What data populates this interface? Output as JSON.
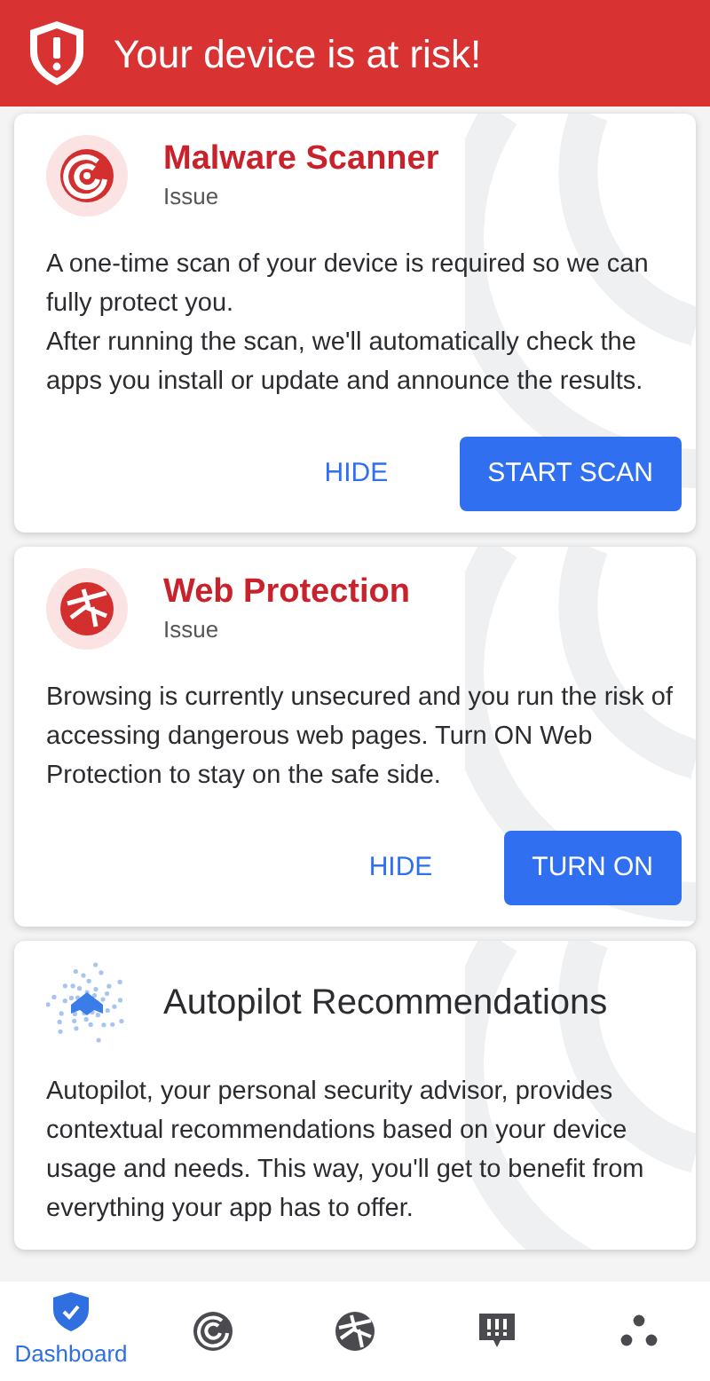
{
  "header": {
    "title": "Your device is at risk!"
  },
  "cards": [
    {
      "kind": "scanner",
      "title": "Malware Scanner",
      "status": "Issue",
      "alert": true,
      "paragraphs": [
        "A one-time scan of your device is required so we can fully protect you.",
        "After running the scan, we'll automatically check the apps you install or update and announce the results."
      ],
      "buttons": [
        {
          "kind": "text",
          "label": "HIDE"
        },
        {
          "kind": "primary",
          "label": "START SCAN"
        }
      ]
    },
    {
      "kind": "web",
      "title": "Web Protection",
      "status": "Issue",
      "alert": true,
      "paragraphs": [
        "Browsing is currently unsecured and you run the risk of accessing dangerous web pages. Turn ON Web Protection to stay on the safe side."
      ],
      "buttons": [
        {
          "kind": "text",
          "label": "HIDE"
        },
        {
          "kind": "primary",
          "label": "TURN ON"
        }
      ]
    },
    {
      "kind": "autopilot",
      "title": "Autopilot Recommendations",
      "alert": false,
      "paragraphs": [
        "Autopilot, your personal security advisor, provides contextual recommendations based on your device usage and needs. This way, you'll get to benefit from everything your app has to offer."
      ]
    }
  ],
  "nav": [
    {
      "kind": "dashboard",
      "label": "Dashboard",
      "selected": true
    },
    {
      "kind": "scanner",
      "selected": false
    },
    {
      "kind": "web",
      "selected": false
    },
    {
      "kind": "messages",
      "selected": false
    },
    {
      "kind": "more",
      "selected": false
    }
  ]
}
